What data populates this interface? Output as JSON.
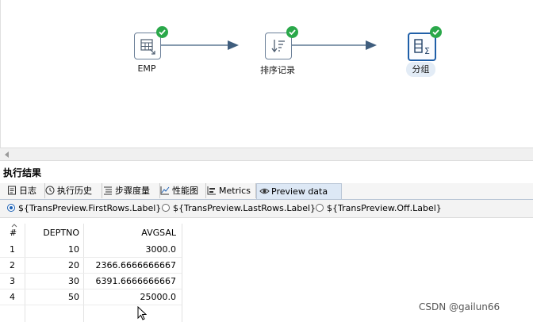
{
  "canvas": {
    "steps": [
      {
        "label": "EMP",
        "icon": "table-input-icon",
        "status": "success"
      },
      {
        "label": "排序记录",
        "icon": "sort-icon",
        "status": "success"
      },
      {
        "label": "分组",
        "icon": "group-by-icon",
        "status": "success",
        "selected": true
      }
    ]
  },
  "results": {
    "title": "执行结果",
    "tabs": [
      {
        "label": "日志",
        "icon": "log-icon"
      },
      {
        "label": "执行历史",
        "icon": "history-icon"
      },
      {
        "label": "步骤度量",
        "icon": "step-metrics-icon"
      },
      {
        "label": "性能图",
        "icon": "performance-chart-icon"
      },
      {
        "label": "Metrics",
        "icon": "metrics-icon"
      },
      {
        "label": "Preview data",
        "icon": "eye-icon",
        "active": true
      }
    ],
    "preview_options": [
      {
        "label": "${TransPreview.FirstRows.Label}",
        "selected": true
      },
      {
        "label": "${TransPreview.LastRows.Label}",
        "selected": false
      },
      {
        "label": "${TransPreview.Off.Label}",
        "selected": false
      }
    ],
    "table": {
      "columns": [
        "#",
        "DEPTNO",
        "AVGSAL"
      ],
      "rows": [
        [
          "1",
          "10",
          "3000.0"
        ],
        [
          "2",
          "20",
          "2366.6666666667"
        ],
        [
          "3",
          "30",
          "6391.6666666667"
        ],
        [
          "4",
          "50",
          "25000.0"
        ]
      ]
    }
  },
  "watermark": "CSDN @gailun66",
  "colors": {
    "success": "#2aa84a",
    "selected_border": "#1f5fa8",
    "hop": "#3f5d7d"
  }
}
